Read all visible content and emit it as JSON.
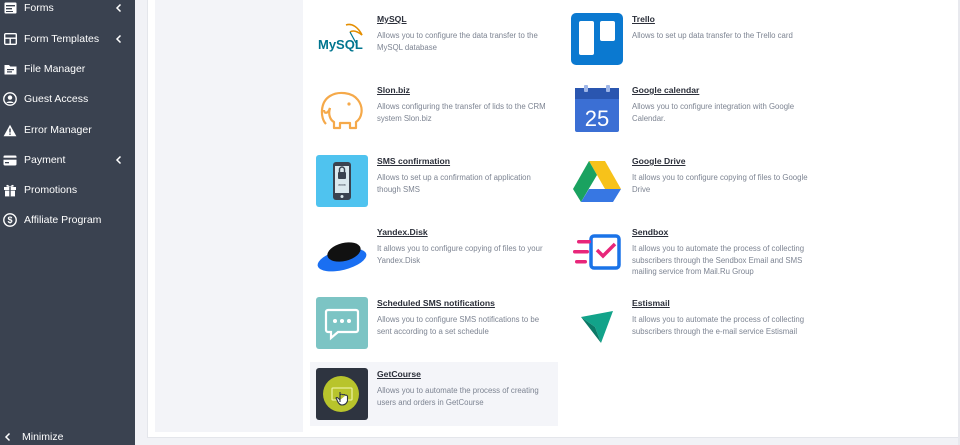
{
  "sidebar": {
    "items": [
      {
        "label": "Forms",
        "icon": "forms-icon",
        "has_submenu": true
      },
      {
        "label": "Form Templates",
        "icon": "form-templates-icon",
        "has_submenu": true
      },
      {
        "label": "File Manager",
        "icon": "file-manager-icon",
        "has_submenu": false
      },
      {
        "label": "Guest Access",
        "icon": "guest-access-icon",
        "has_submenu": false
      },
      {
        "label": "Error Manager",
        "icon": "warning-icon",
        "has_submenu": false
      },
      {
        "label": "Payment",
        "icon": "payment-card-icon",
        "has_submenu": true
      },
      {
        "label": "Promotions",
        "icon": "gift-icon",
        "has_submenu": false
      },
      {
        "label": "Affiliate Program",
        "icon": "dollar-icon",
        "has_submenu": false
      }
    ],
    "minimize_label": "Minimize"
  },
  "integrations": [
    {
      "title": "MySQL",
      "description": "Allows you to configure the data transfer to the MySQL database",
      "logo_text": "MySQL"
    },
    {
      "title": "Trello",
      "description": "Allows to set up data transfer to the Trello card"
    },
    {
      "title": "Slon.biz",
      "description": "Allows configuring the transfer of lids to the CRM system Slon.biz"
    },
    {
      "title": "Google calendar",
      "description": "Allows you to configure integration with Google Calendar.",
      "logo_text": "25"
    },
    {
      "title": "SMS confirmation",
      "description": "Allows to set up a confirmation of application though SMS",
      "logo_text": "****"
    },
    {
      "title": "Google Drive",
      "description": "It allows you to configure copying of files to Google Drive"
    },
    {
      "title": "Yandex.Disk",
      "description": "It allows you to configure copying of files to your Yandex.Disk"
    },
    {
      "title": "Sendbox",
      "description": "It allows you to automate the process of collecting subscribers through the Sendbox Email and SMS mailing service from Mail.Ru Group"
    },
    {
      "title": "Scheduled SMS notifications",
      "description": "Allows you to configure SMS notifications to be sent according to a set schedule"
    },
    {
      "title": "Estismail",
      "description": "It allows you to automate the process of collecting subscribers through the e-mail service Estismail"
    },
    {
      "title": "GetCourse",
      "description": "Allows you to automate the process of creating users and orders in GetCourse"
    }
  ],
  "colors": {
    "sidebar_bg": "#3a4250",
    "trello_blue": "#0b79d0",
    "slon_orange": "#f5a94a",
    "sms_blue": "#4fc3ef",
    "yandex_blue": "#1a6ff2",
    "sendbox_pink": "#e8267a",
    "sendbox_blue": "#1a73e8",
    "scheduled_teal": "#7cc4c4",
    "estismail_green": "#12a38a",
    "getcourse_dark": "#2e3440",
    "getcourse_lime": "#c8d42a"
  }
}
